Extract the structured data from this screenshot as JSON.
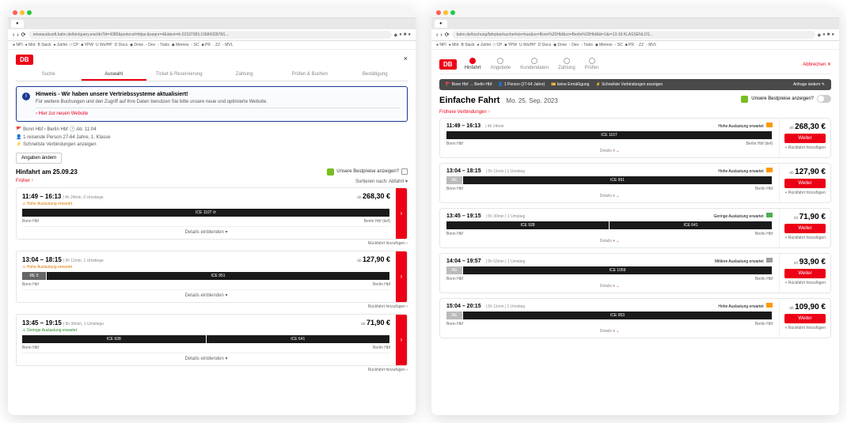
{
  "left": {
    "url": "reiseauskunft.bahn.de/bin/query.exe/dn?ld=4380&protocol=https:&seqnr=4&ident=ih.02337083.1068432878/L...",
    "logo": "DB",
    "close": "×",
    "step_tabs": [
      "Suche",
      "Auswahl",
      "Ticket & Reservierung",
      "Zahlung",
      "Prüfen & Buchen",
      "Bestätigung"
    ],
    "active_step": 1,
    "notice_title": "Hinweis - Wir haben unsere Vertriebssysteme aktualisiert!",
    "notice_body": "Für weitere Buchungen und den Zugriff auf Ihre Daten benutzen Sie bitte unsere neue und optimierte Website.",
    "notice_link": "Hier zur neuen Website",
    "meta": {
      "route": "Bonn Hbf  ›  Berlin Hbf   🕐 Ab: 11:04",
      "pax": "1 reisende Person 27-64 Jahre, 1. Klasse",
      "fast": "Schnellste Verbindungen anzeigen"
    },
    "change_btn": "Angaben ändern",
    "section": "Hinfahrt am 25.09.23",
    "bestprice": "Unsere Bestpreise anzeigen?",
    "earlier": "Früher  ↑",
    "sort": "Sortieren nach: Abfahrt  ▾",
    "details_label": "Details einblenden  ▾",
    "add_return": "Rückfahrt hinzufügen  ›",
    "journeys": [
      {
        "times": "11:49 – 16:13",
        "dur": "4h 24min, 0 Umstiege",
        "load": "Hohe Auslastung erwartet",
        "price": "268,30 €",
        "segs": [
          {
            "label": "ICE 1107 ⟳",
            "cls": ""
          }
        ],
        "from": "Bonn Hbf",
        "to": "Berlin Hbf (tief)"
      },
      {
        "times": "13:04 – 18:15",
        "dur": "5h 11min, 1 Umstiege",
        "load": "Hohe Auslastung erwartet",
        "price": "127,90 €",
        "segs": [
          {
            "label": "RE 5",
            "cls": "re"
          },
          {
            "label": "ICE 951",
            "cls": ""
          }
        ],
        "from": "Bonn Hbf",
        "to": "Berlin Hbf"
      },
      {
        "times": "13:45 – 19:15",
        "dur": "5h 30min, 1 Umstiege",
        "load": "Geringe Auslastung erwartet",
        "load_cls": "green",
        "price": "71,90 €",
        "segs": [
          {
            "label": "ICE 928",
            "cls": ""
          },
          {
            "label": "ICE 641",
            "cls": ""
          }
        ],
        "from": "Bonn Hbf",
        "to": "Berlin Hbf"
      }
    ]
  },
  "right": {
    "url": "bahn.de/buchung/fahrplan/suche#sts=true&so=Bonn%20Hbf&zo=Berlin%20Hbf&kl=1&r=13:16:KLASSENLOS...",
    "logo": "DB",
    "steps": [
      "Hinfahrt",
      "Angebote",
      "Kundendaten",
      "Zahlung",
      "Prüfen"
    ],
    "cancel": "Abbrechen ✕",
    "summary": {
      "route": "Bonn Hbf → Berlin Hbf",
      "pax": "1 Person (27-64 Jahre)",
      "disc": "keine Ermäßigung",
      "fast": "Schnellste Verbindungen anzeigen",
      "change": "Anfrage ändern ✎"
    },
    "title": "Einfache Fahrt",
    "date": "Mo. 25. Sep. 2023",
    "bestprice": "Unsere Bestpreise anzeigen?",
    "earlier": "Frühere Verbindungen ↑",
    "details": "Details ▾",
    "weiter": "Weiter",
    "rueck": "+ Rückfahrt hinzufügen",
    "ab": "ab",
    "journeys": [
      {
        "times": "11:49 – 16:13",
        "dur": "4h 24min",
        "chg": "",
        "load": "Hohe Auslastung erwartet",
        "load_cls": "high",
        "price": "268,30 €",
        "segs": [
          {
            "label": "ICE 1107"
          }
        ],
        "from": "Bonn Hbf",
        "to": "Berlin Hbf (tief)"
      },
      {
        "times": "13:04 – 18:15",
        "dur": "5h 11min",
        "chg": "1 Umstieg",
        "load": "Hohe Auslastung erwartet",
        "load_cls": "high",
        "price": "127,90 €",
        "segs": [
          {
            "label": "RE",
            "cls": "gray"
          },
          {
            "label": "ICE 951"
          }
        ],
        "from": "Bonn Hbf",
        "to": "Berlin Hbf"
      },
      {
        "times": "13:45 – 19:15",
        "dur": "5h 30min",
        "chg": "1 Umstieg",
        "load": "Geringe Auslastung erwartet",
        "load_cls": "low",
        "price": "71,90 €",
        "segs": [
          {
            "label": "ICE 928"
          },
          {
            "label": "ICE 641"
          }
        ],
        "from": "Bonn Hbf",
        "to": "Berlin Hbf"
      },
      {
        "times": "14:04 – 19:57",
        "dur": "5h 53min",
        "chg": "1 Umstieg",
        "load": "Mittlere Auslastung erwartet",
        "load_cls": "mid",
        "price": "93,90 €",
        "segs": [
          {
            "label": "RE",
            "cls": "gray"
          },
          {
            "label": "ICE 1059"
          }
        ],
        "from": "Bonn Hbf",
        "to": "Berlin Hbf"
      },
      {
        "times": "15:04 – 20:15",
        "dur": "5h 11min",
        "chg": "1 Umstieg",
        "load": "Hohe Auslastung erwartet",
        "load_cls": "high",
        "price": "109,90 €",
        "segs": [
          {
            "label": "RE",
            "cls": "gray"
          },
          {
            "label": "ICE 953"
          }
        ],
        "from": "Bonn Hbf",
        "to": "Berlin Hbf"
      }
    ]
  },
  "bookmarks": [
    "● NPI",
    "● Mnt",
    "B Slack",
    "● Jst/int",
    "□ CP",
    "■ YPW",
    "U Wo/HP",
    "D Docs",
    "◆ Drive",
    "▫ Dev",
    "▫ Tools",
    "◆ Memos",
    "▫ SC",
    "■ PR",
    "· ZZ",
    "- MVL"
  ]
}
